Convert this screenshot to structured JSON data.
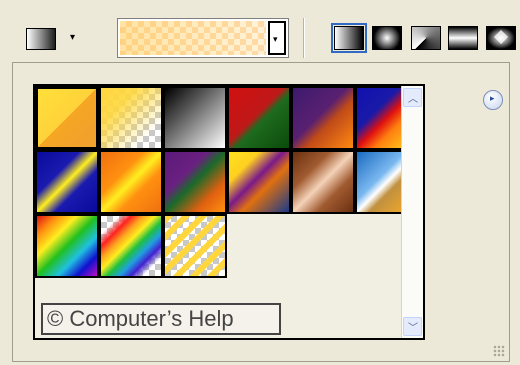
{
  "toolbar": {
    "gradient_tool_icon": "gradient-tool-icon",
    "gradient_tool_dropdown_glyph": "▾",
    "picker_dropdown_glyph": "▾",
    "gradient_types": [
      {
        "name": "linear-gradient-icon",
        "selected": true
      },
      {
        "name": "radial-gradient-icon",
        "selected": false
      },
      {
        "name": "angle-gradient-icon",
        "selected": false
      },
      {
        "name": "reflected-gradient-icon",
        "selected": false
      },
      {
        "name": "diamond-gradient-icon",
        "selected": false
      }
    ]
  },
  "panel": {
    "menu_glyph": "▸",
    "watermark_text": "© Computer’s Help",
    "scroll_up_glyph": "︿",
    "scroll_down_glyph": "﹀",
    "presets": [
      {
        "name": "foreground-to-background",
        "bg": "linear-gradient(135deg,#ffe03a 0%,#ffd23a 50%,#f5a623 50%,#f0a030 100%)",
        "checker": false,
        "selected": true
      },
      {
        "name": "foreground-to-transparent",
        "bg": "linear-gradient(135deg,rgba(255,215,60,1) 0%,rgba(255,215,60,0.9) 30%,rgba(255,215,60,0) 80%)",
        "checker": true,
        "selected": false
      },
      {
        "name": "black-white",
        "bg": "linear-gradient(135deg,#000 0%,#555 35%,#fff 100%)",
        "checker": false,
        "selected": false
      },
      {
        "name": "red-green",
        "bg": "linear-gradient(135deg,#d01010 0%,#c01818 45%,#1f6b1f 55%,#0a4a0a 100%)",
        "checker": false,
        "selected": false
      },
      {
        "name": "violet-orange",
        "bg": "linear-gradient(135deg,#3c1a6e 0%,#5a2070 45%,#c04a18 60%,#ff8a10 100%)",
        "checker": false,
        "selected": false
      },
      {
        "name": "blue-red-yellow",
        "bg": "linear-gradient(135deg,#1010b0 0%,#1a1aa8 35%,#e01010 50%,#ff8010 65%,#ffe020 100%)",
        "checker": false,
        "selected": false
      },
      {
        "name": "blue-yellow-blue",
        "bg": "linear-gradient(135deg,#0a0a9a 0%,#1a1ab0 35%,#ffee20 50%,#1a1ab0 65%,#0a0a9a 100%)",
        "checker": false,
        "selected": false
      },
      {
        "name": "orange-yellow-orange",
        "bg": "linear-gradient(135deg,#f07010 0%,#ff9010 35%,#ffee20 50%,#ff9010 65%,#f07010 100%)",
        "checker": false,
        "selected": false
      },
      {
        "name": "violet-green-orange",
        "bg": "linear-gradient(135deg,#5a1a7a 0%,#6a2080 35%,#1a6a2a 50%,#e06010 75%,#ff9010 100%)",
        "checker": false,
        "selected": false
      },
      {
        "name": "yellow-violet-orange-blue",
        "bg": "linear-gradient(135deg,#ffe020 0%,#ffd020 25%,#7a1a8a 45%,#e07010 60%,#1a3a8a 100%)",
        "checker": false,
        "selected": false
      },
      {
        "name": "copper",
        "bg": "linear-gradient(135deg,#6a3010 0%,#a05a30 30%,#f4d2b8 50%,#a05a30 70%,#6a3010 100%)",
        "checker": false,
        "selected": false
      },
      {
        "name": "chrome",
        "bg": "linear-gradient(135deg,#1a6ac0 0%,#7ab8f0 40%,#ffffff 50%,#c09040 60%,#ffb020 100%)",
        "checker": false,
        "selected": false
      },
      {
        "name": "spectrum",
        "bg": "linear-gradient(135deg,#e01010 0%,#ff9010 17%,#ffee20 33%,#20c020 50%,#20c0e0 67%,#1010d0 83%,#c010c0 100%)",
        "checker": false,
        "selected": false
      },
      {
        "name": "transparent-rainbow",
        "bg": "linear-gradient(135deg,rgba(255,0,0,0) 0%,rgba(255,0,0,0) 15%,#ff2020 25%,#ffa020 35%,#ffee20 45%,#20c040 55%,#20a0e0 65%,#4020d0 75%,rgba(160,20,200,0) 85%)",
        "checker": true,
        "selected": false
      },
      {
        "name": "transparent-stripes",
        "bg": "repeating-linear-gradient(135deg,rgba(255,215,60,1) 0px,rgba(255,215,60,1) 6px,rgba(255,215,60,0) 6px,rgba(255,215,60,0) 12px)",
        "checker": true,
        "selected": false
      }
    ]
  }
}
